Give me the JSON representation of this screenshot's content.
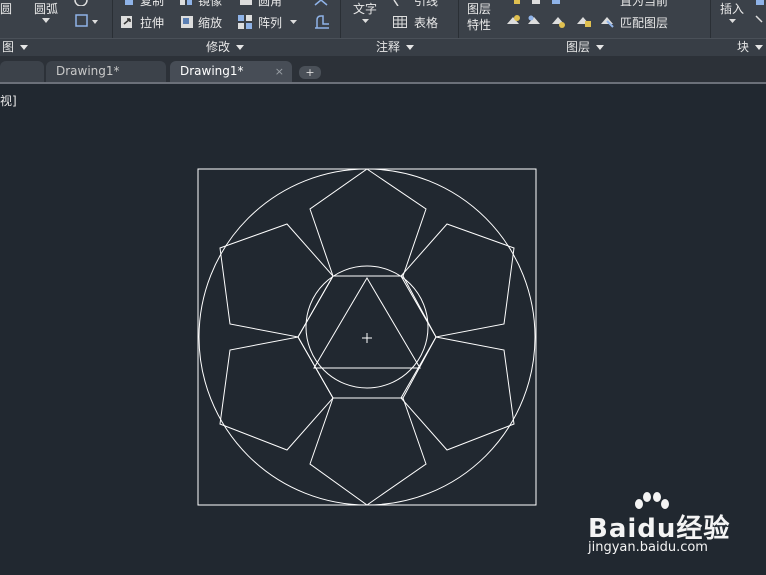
{
  "ribbon": {
    "draw_panel": {
      "circle_label": "圆",
      "arc_label": "圆弧",
      "title": "图"
    },
    "modify_panel": {
      "copy_label": "复制",
      "mirror_label": "镜像",
      "fillet_label": "圆角",
      "stretch_label": "拉伸",
      "scale_label": "缩放",
      "array_label": "阵列",
      "title": "修改"
    },
    "annotation_panel": {
      "text_label": "文字",
      "leader_label": "引线",
      "table_label": "表格",
      "title": "注释"
    },
    "layers_panel": {
      "layer_props_label_1": "图层",
      "layer_props_label_2": "特性",
      "set_current_label": "置为当前",
      "match_layer_label": "匹配图层",
      "title": "图层"
    },
    "block_panel": {
      "insert_label": "插入",
      "title": "块"
    }
  },
  "tabs": [
    {
      "label": "Drawing1*"
    },
    {
      "label": "Drawing1*"
    }
  ],
  "new_tab_label": "+",
  "close_glyph": "×",
  "viewport": {
    "label": "[俯视][二维线框]",
    "label_visible": "视]",
    "background": "#212830",
    "line_color": "#ffffff"
  },
  "watermark": {
    "brand": "Baidu经验",
    "url": "jingyan.baidu.com"
  }
}
